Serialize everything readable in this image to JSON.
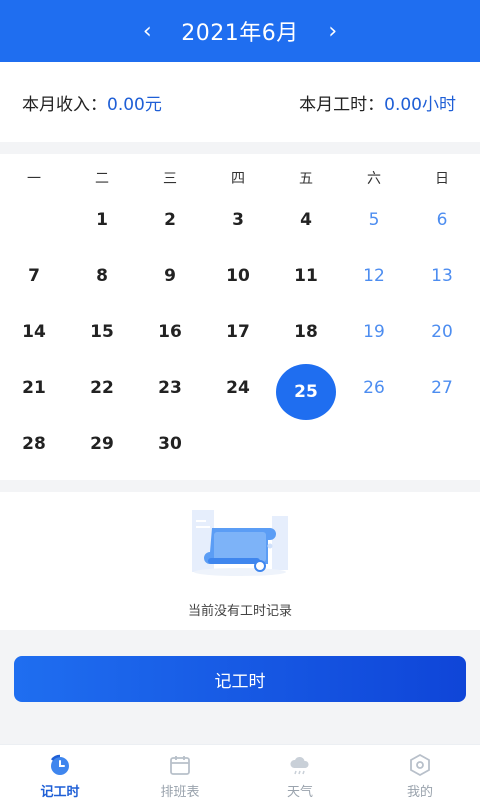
{
  "header": {
    "prev_label": "‹",
    "title": "2021年6月",
    "next_label": "›"
  },
  "summary": {
    "income_label": "本月收入：",
    "income_value": "0.00元",
    "hours_label": "本月工时：",
    "hours_value": "0.00小时"
  },
  "calendar": {
    "weekdays": [
      "一",
      "二",
      "三",
      "四",
      "五",
      "六",
      "日"
    ],
    "days": [
      "1",
      "2",
      "3",
      "4",
      "5",
      "6",
      "7",
      "8",
      "9",
      "10",
      "11",
      "12",
      "13",
      "14",
      "15",
      "16",
      "17",
      "18",
      "19",
      "20",
      "21",
      "22",
      "23",
      "24",
      "25",
      "26",
      "27",
      "28",
      "29",
      "30"
    ],
    "selected_day": "25"
  },
  "empty_state": {
    "message": "当前没有工时记录"
  },
  "primary_button": {
    "label": "记工时"
  },
  "tabs": [
    {
      "label": "记工时",
      "icon": "clock-icon",
      "active": true
    },
    {
      "label": "排班表",
      "icon": "calendar-icon",
      "active": false
    },
    {
      "label": "天气",
      "icon": "cloud-icon",
      "active": false
    },
    {
      "label": "我的",
      "icon": "hexagon-icon",
      "active": false
    }
  ],
  "colors": {
    "accent": "#1f6ef0",
    "weekend": "#4d8df0",
    "inactive_tab": "#9aa3ad"
  }
}
